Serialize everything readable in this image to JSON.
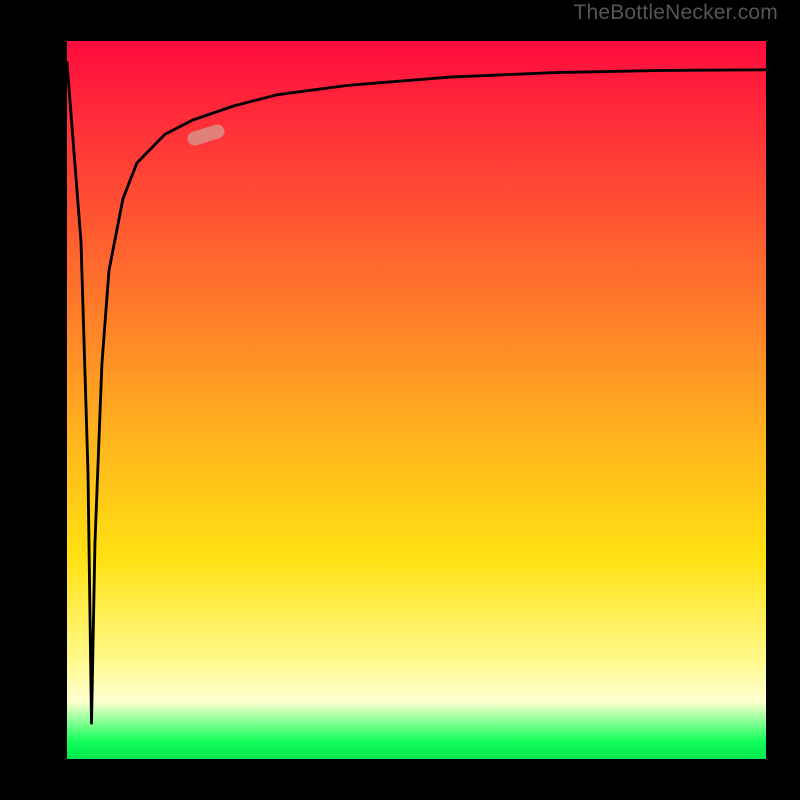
{
  "watermark": "TheBottleNecker.com",
  "colors": {
    "frame": "#000000",
    "gradient_top": "#ff0c3d",
    "gradient_mid1": "#ff8a27",
    "gradient_mid2": "#ffe112",
    "gradient_pale": "#ffffd0",
    "gradient_bottom": "#00e84d",
    "curve": "#000000",
    "marker": "rgba(214,150,140,0.78)"
  },
  "chart_data": {
    "type": "line",
    "title": "",
    "xlabel": "",
    "ylabel": "",
    "xlim": [
      0,
      100
    ],
    "ylim": [
      0,
      100
    ],
    "series": [
      {
        "name": "bottleneck-curve",
        "x": [
          0,
          2,
          3,
          3.5,
          4,
          5,
          6,
          8,
          10,
          14,
          18,
          24,
          30,
          40,
          55,
          70,
          85,
          100
        ],
        "y": [
          97,
          72,
          40,
          5,
          30,
          55,
          68,
          78,
          83,
          87,
          89,
          91,
          92.5,
          93.8,
          95.0,
          95.6,
          95.9,
          96.0
        ]
      }
    ],
    "annotations": [
      {
        "name": "highlight-marker",
        "x": 19,
        "y": 87.5,
        "rotation_deg": -17
      }
    ],
    "notes": "y-values are percentage heights (0 bottom, 100 top) estimated from the image; x is percentage across plot width. Curve starts near top-left, drops sharply to a deep narrow trough at x≈3.5 reaching near the bottom, then rises steeply and asymptotes near y≈96."
  }
}
